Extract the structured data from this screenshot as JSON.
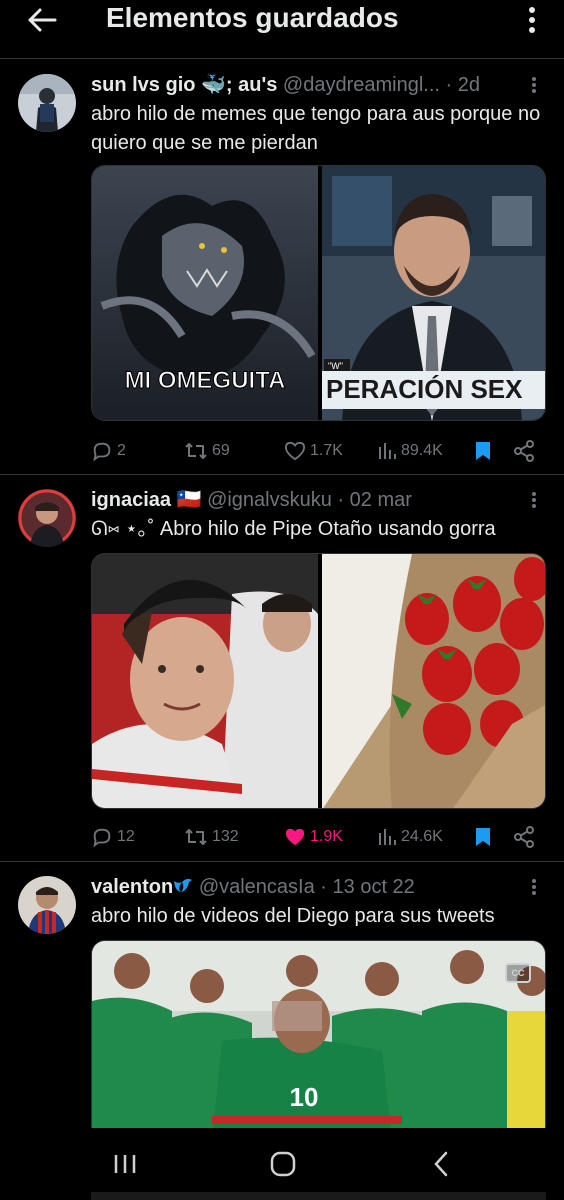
{
  "header": {
    "title": "Elementos guardados",
    "back_icon": "arrow-left-icon",
    "more_icon": "more-vertical-icon"
  },
  "tweets": [
    {
      "name": "sun lvs gio 🐳; au's",
      "handle": "@daydreamingl...",
      "time": "· 2d",
      "text": "abro hilo de memes que tengo para aus porque no quiero que se me pierdan",
      "media": [
        {
          "caption": "MI OMEGUITA"
        },
        {
          "caption": "PERACIÓN SEX",
          "tag": "\"W\""
        }
      ],
      "stats": {
        "replies": "2",
        "reposts": "69",
        "likes": "1.7K",
        "views": "89.4K"
      },
      "liked": false,
      "bookmarked": true
    },
    {
      "name": "ignaciaa 🇨🇱",
      "handle": "@ignalvskuku",
      "time": "· 02 mar",
      "text": "ᘏ⑅ ⋆｡˚ Abro hilo de Pipe Otaño usando gorra",
      "stats": {
        "replies": "12",
        "reposts": "132",
        "likes": "1.9K",
        "views": "24.6K"
      },
      "liked": true,
      "bookmarked": true
    },
    {
      "name": "valenton",
      "handle": "@valencasIa",
      "time": "· 13 oct 22",
      "text": "abro hilo de videos del Diego para sus tweets",
      "media": [
        {
          "jersey_number": "10",
          "cc_label": "CC"
        }
      ]
    }
  ],
  "colors": {
    "background": "#000000",
    "text_primary": "#e7e9ea",
    "text_secondary": "#71767b",
    "accent_blue": "#1d9bf0",
    "like_pink": "#f91880",
    "divider": "#2f3336"
  },
  "navbar": {
    "icons": [
      "recent-apps-icon",
      "home-icon",
      "back-icon"
    ]
  }
}
